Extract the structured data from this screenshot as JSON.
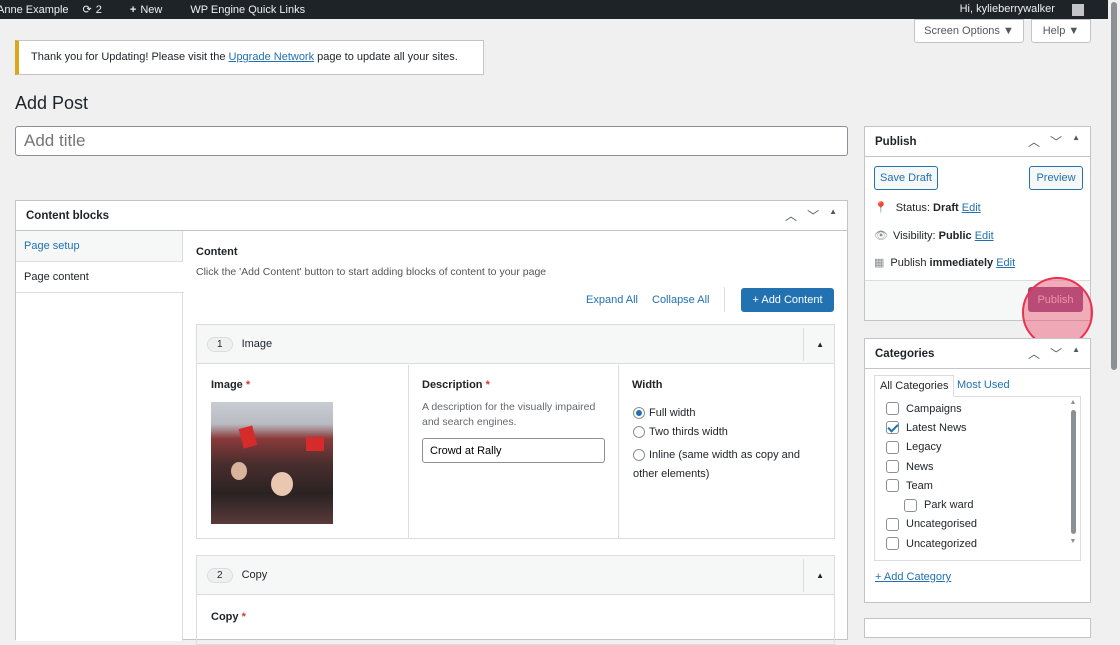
{
  "adminbar": {
    "site": "Anne Example",
    "updates": "2",
    "new": "New",
    "quicklinks": "WP Engine Quick Links",
    "greeting": "Hi, kylieberrywalker"
  },
  "screen_options": "Screen Options ▼",
  "help": "Help ▼",
  "notice": {
    "before": "Thank you for Updating! Please visit the ",
    "link": "Upgrade Network",
    "after": " page to update all your sites."
  },
  "page_title": "Add Post",
  "title_placeholder": "Add title",
  "content_blocks": {
    "title": "Content blocks",
    "tabs": [
      "Page setup",
      "Page content"
    ],
    "heading": "Content",
    "description": "Click the 'Add Content' button to start adding blocks of content to your page",
    "expand_all": "Expand All",
    "collapse_all": "Collapse All",
    "add_content": "+ Add Content",
    "blocks": [
      {
        "num": "1",
        "name": "Image",
        "image_label": "Image",
        "desc_label": "Description",
        "desc_help": "A description for the visually impaired and search engines.",
        "desc_value": "Crowd at Rally",
        "width_label": "Width",
        "width_options": [
          "Full width",
          "Two thirds width",
          "Inline (same width as copy and other elements)"
        ],
        "width_selected": 0
      },
      {
        "num": "2",
        "name": "Copy",
        "copy_label": "Copy"
      }
    ]
  },
  "publish": {
    "title": "Publish",
    "save_draft": "Save Draft",
    "preview": "Preview",
    "status_label": "Status:",
    "status": "Draft",
    "visibility_label": "Visibility:",
    "visibility": "Public",
    "publish_label": "Publish",
    "publish_when": "immediately",
    "edit": "Edit",
    "publish_button": "Publish"
  },
  "categories": {
    "title": "Categories",
    "tab_all": "All Categories",
    "tab_most": "Most Used",
    "items": [
      {
        "label": "Campaigns",
        "checked": false
      },
      {
        "label": "Latest News",
        "checked": true
      },
      {
        "label": "Legacy",
        "checked": false
      },
      {
        "label": "News",
        "checked": false
      },
      {
        "label": "Team",
        "checked": false
      },
      {
        "label": "Park ward",
        "checked": false,
        "child": true
      },
      {
        "label": "Uncategorised",
        "checked": false
      },
      {
        "label": "Uncategorized",
        "checked": false
      }
    ],
    "add": "+ Add Category"
  },
  "colors": {
    "accent": "#2271b1",
    "publish_btn": "#8e4a7c",
    "highlight": "#e8334f"
  }
}
